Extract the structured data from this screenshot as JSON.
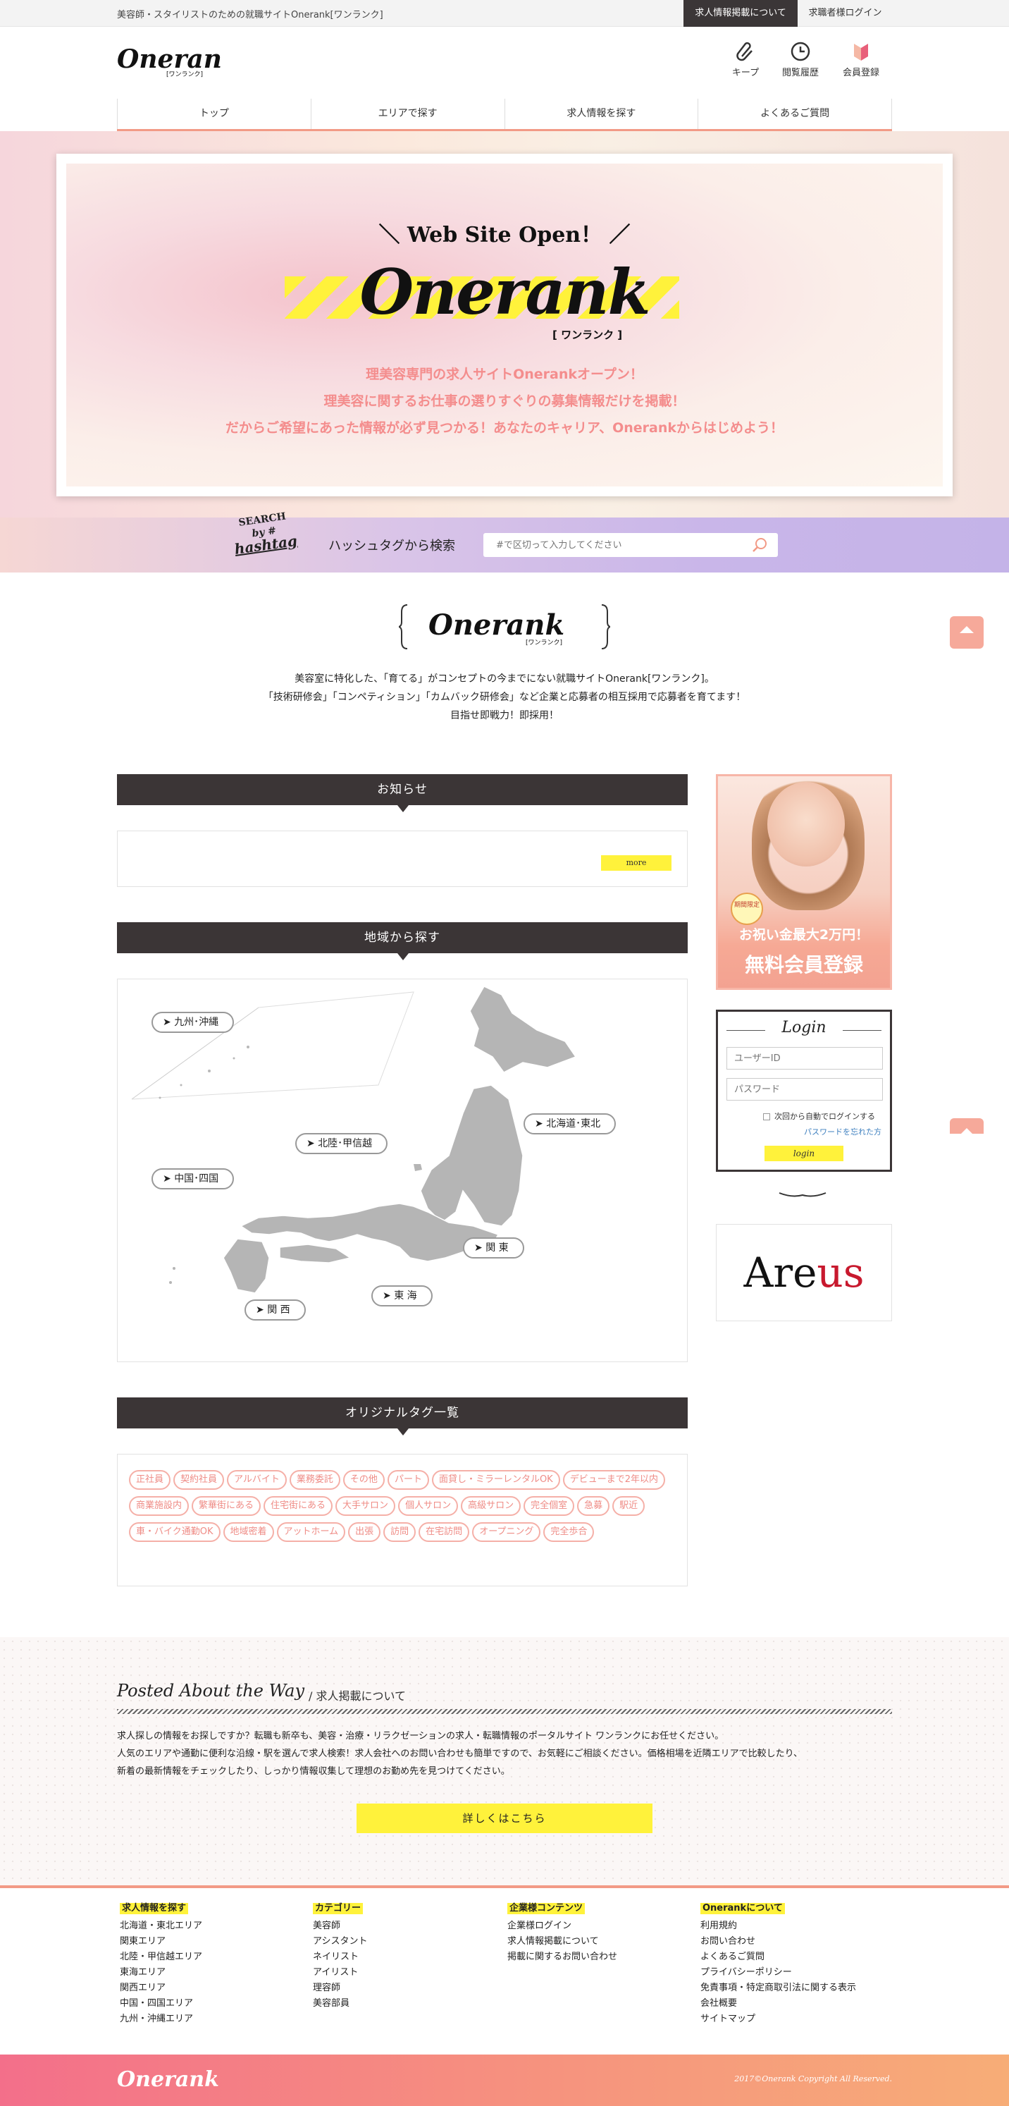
{
  "topbar": {
    "tagline": "美容師・スタイリストのための就職サイトOnerank[ワンランク]",
    "btn_posting": "求人情報掲載について",
    "btn_login": "求職者様ログイン"
  },
  "header": {
    "logo": "Onerank",
    "logo_sub": "[ワンランク]",
    "icons": [
      {
        "icon": "paperclip-icon",
        "label": "キープ"
      },
      {
        "icon": "clock-icon",
        "label": "閲覧履歴"
      },
      {
        "icon": "beginner-mark-icon",
        "label": "会員登録"
      }
    ]
  },
  "nav": [
    "トップ",
    "エリアで探す",
    "求人情報を探す",
    "よくあるご質問"
  ],
  "hero": {
    "open": "＼ Web Site Open！ ／",
    "logo": "Onerank",
    "logo_sub": "[ ワンランク ]",
    "line1": "理美容専門の求人サイトOnerankオープン！",
    "line2": "理美容に関するお仕事の選りすぐりの募集情報だけを掲載！",
    "line3": "だからご希望にあった情報が必ず見つかる！あなたのキャリア、Onerankからはじめよう！"
  },
  "hashtag": {
    "badge1": "SEARCH",
    "badge2": "by #",
    "badge3": "hashtag",
    "label": "ハッシュタグから検索",
    "placeholder": "#で区切って入力してください"
  },
  "intro": {
    "logo": "Onerank",
    "logo_sub": "[ワンランク]",
    "line1": "美容室に特化した、「育てる」がコンセプトの今までにない就職サイトOnerank[ワンランク]。",
    "line2": "「技術研修会」「コンペティション」「カムバック研修会」など企業と応募者の相互採用で応募者を育てます！",
    "line3": "目指せ即戦力！即採用！"
  },
  "news": {
    "title": "お知らせ",
    "more": "more"
  },
  "area": {
    "title": "地域から探す",
    "labels": [
      "九州･沖縄",
      "北海道･東北",
      "北陸･甲信越",
      "中国･四国",
      "関 東",
      "東 海",
      "関 西"
    ]
  },
  "tags": {
    "title": "オリジナルタグ一覧",
    "items": [
      "正社員",
      "契約社員",
      "アルバイト",
      "業務委託",
      "その他",
      "パート",
      "面貸し・ミラーレンタルOK",
      "デビューまで2年以内",
      "商業施設内",
      "繁華街にある",
      "住宅街にある",
      "大手サロン",
      "個人サロン",
      "高級サロン",
      "完全個室",
      "急募",
      "駅近",
      "車・バイク通勤OK",
      "地域密着",
      "アットホーム",
      "出張",
      "訪問",
      "在宅訪問",
      "オープニング",
      "完全歩合"
    ]
  },
  "banner": {
    "stamp": "期間限定",
    "line1": "お祝い金最大2万円！",
    "line2": "無料会員登録"
  },
  "login": {
    "title": "Login",
    "user_placeholder": "ユーザーID",
    "pass_placeholder": "パスワード",
    "remember": "次回から自動でログインする",
    "forgot": "パスワードを忘れた方",
    "button": "login"
  },
  "areus": {
    "a": "Are",
    "b": "us"
  },
  "posted": {
    "title": "Posted About the Way",
    "sub": "/ 求人掲載について",
    "line1": "求人探しの情報をお探しですか？転職も新卒も、美容・治療・リラクゼーションの求人・転職情報のポータルサイト ワンランクにお任せください。",
    "line2": "人気のエリアや通勤に便利な沿線・駅を選んで求人検索！求人会社へのお問い合わせも簡単ですので、お気軽にご相談ください。価格相場を近隣エリアで比較したり、",
    "line3": "新着の最新情報をチェックしたり、しっかり情報収集して理想のお勤め先を見つけてください。",
    "button": "詳しくはこちら"
  },
  "footer": {
    "cols": [
      {
        "title": "求人情報を探す",
        "items": [
          "北海道・東北エリア",
          "関東エリア",
          "北陸・甲信越エリア",
          "東海エリア",
          "関西エリア",
          "中国・四国エリア",
          "九州・沖縄エリア"
        ]
      },
      {
        "title": "カテゴリー",
        "items": [
          "美容師",
          "アシスタント",
          "ネイリスト",
          "アイリスト",
          "理容師",
          "美容部員"
        ]
      },
      {
        "title": "企業様コンテンツ",
        "items": [
          "企業様ログイン",
          "求人情報掲載について",
          "掲載に関するお問い合わせ"
        ]
      },
      {
        "title": "Onerankについて",
        "items": [
          "利用規約",
          "お問い合わせ",
          "よくあるご質問",
          "プライバシーポリシー",
          "免責事項・特定商取引法に関する表示",
          "会社概要",
          "サイトマップ"
        ]
      }
    ],
    "logo": "Onerank",
    "copyright": "2017©Onerank Copyright All Reserved."
  }
}
